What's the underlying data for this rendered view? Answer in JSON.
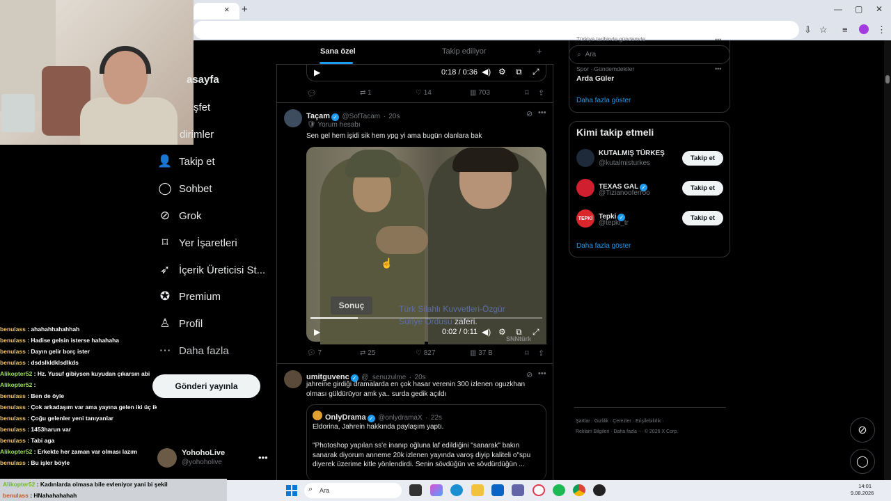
{
  "browser": {
    "new_tab": "+",
    "close_tab": "×",
    "win_min": "—",
    "win_max": "▢",
    "win_close": "✕"
  },
  "nav": {
    "home": "asayfa",
    "explore": "şfet",
    "notifications": "dirimler",
    "items": [
      {
        "label": "Takip et",
        "icon": "add-user-icon"
      },
      {
        "label": "Sohbet",
        "icon": "chat-icon"
      },
      {
        "label": "Grok",
        "icon": "grok-icon"
      },
      {
        "label": "Yer İşaretleri",
        "icon": "bookmark-icon"
      },
      {
        "label": "İçerik Üreticisi St...",
        "icon": "rocket-icon"
      },
      {
        "label": "Premium",
        "icon": "premium-icon"
      },
      {
        "label": "Profil",
        "icon": "profile-icon"
      },
      {
        "label": "Daha fazla",
        "icon": "more-icon"
      }
    ],
    "post_button": "Gönderi yayınla",
    "account_name": "YohohoLive",
    "account_handle": "@yohoholive",
    "account_more": "•••"
  },
  "chat": {
    "lines": [
      {
        "user": "benulass",
        "msg": ": ahahahhahahhah",
        "green": false
      },
      {
        "user": "benulass",
        "msg": ": Hadise gelsin isterse hahahaha",
        "green": false
      },
      {
        "user": "benulass",
        "msg": ": Dayın gelir borç ister",
        "green": false
      },
      {
        "user": "benulass",
        "msg": ": dsdslkldklsdlkds",
        "green": false
      },
      {
        "user": "Alikopter52",
        "msg": ": Hz. Yusuf gibiysen kuyudan çıkarsın abi",
        "green": true
      },
      {
        "user": "Alikopter52",
        "msg": ":",
        "green": true
      },
      {
        "user": "benulass",
        "msg": ": Ben de öyle",
        "green": false
      },
      {
        "user": "benulass",
        "msg": ": Çok arkadaşım var ama yayına gelen iki üç ikiş",
        "green": false
      },
      {
        "user": "benulass",
        "msg": ": Çoğu gelenler yeni tanıyanlar",
        "green": false
      },
      {
        "user": "benulass",
        "msg": ": 1453harun var",
        "green": false
      },
      {
        "user": "benulass",
        "msg": ": Tabi aga",
        "green": false
      },
      {
        "user": "Alikopter52",
        "msg": ": Erkekte her zaman var olması lazım",
        "green": true
      },
      {
        "user": "benulass",
        "msg": ": Bu işler böyle",
        "green": false
      }
    ],
    "bottom": [
      {
        "user": "Alikopter52",
        "msg": ": Kadınlarda olmasa bile evleniyor yani bi şekil"
      },
      {
        "user": "benulass",
        "msg": ": HNahahahahah"
      }
    ]
  },
  "timeline": {
    "tab_foryou": "Sana özel",
    "tab_following": "Takip ediliyor",
    "tab_plus": "+",
    "post1": {
      "time": "0:18 / 0:36",
      "replies": "",
      "reposts": "1",
      "likes": "14",
      "views": "703"
    },
    "post2": {
      "name": "Taçam",
      "handle": "@SofTacam",
      "time": "20s",
      "label": "Yorum hesabı",
      "text": "Sen  gel hem işidi sik hem ypg yi ama bugün olanlara bak",
      "video_badge": "Sonuç",
      "sub1": "Türk Silahlı Kuvvetleri-Özgür",
      "sub2_a": "Suriye Ordusu ",
      "sub2_b": "zaferi.",
      "watermark": "SNNtürk",
      "video_time": "0:02 / 0:11",
      "replies": "7",
      "reposts": "25",
      "likes": "827",
      "views": "37 B"
    },
    "post3": {
      "name": "umitguvenc",
      "handle": "@_senuzulme",
      "time": "20s",
      "text": "jahreine girdiği dramalarda en çok hasar verenin 300 izlenen oguzkhan olması güldürüyor amk ya.. surda gedik açıldı",
      "quote_name": "OnlyDrama",
      "quote_handle": "@onlydramaX",
      "quote_time": "22s",
      "quote_line1": "Eldorina, Jahrein hakkında paylaşım yaptı.",
      "quote_body": "\"Photoshop yapılan ss'e inanıp oğluna laf edildiğini \"sanarak\" bakın sanarak diyorum anneme 20k izlenen yayında varoş diyip kaliteli o\"spu diyerek üzerime kitle yönlendirdi. Senin sövdüğün ve sövdürdüğün ..."
    }
  },
  "right": {
    "search_placeholder": "Ara",
    "trend_header": "Türkiye tarihinde gündemde",
    "trend_cat": "Spor · Gündemdekiler",
    "trend_name": "Arda Güler",
    "show_more": "Daha fazla göster",
    "who_title": "Kimi takip etmeli",
    "who": [
      {
        "name": "KUTALMIŞ TÜRKEŞ",
        "handle": "@kutalmisturkes",
        "verified": false,
        "button": "Takip et"
      },
      {
        "name": "TEXAS GAL",
        "handle": "@Tizianooferroo",
        "verified": true,
        "button": "Takip et"
      },
      {
        "name": "Tepki",
        "handle": "@tepki_tr",
        "verified": true,
        "button": "Takip et"
      }
    ],
    "who_more": "Daha fazla göster",
    "footer1": "Şartlar  ·  Gizlilik  ·  Çerezler  ·  Erişilebilirlik  ·",
    "footer2": "Reklam Bilgileri  ·  Daha fazla ···  © 2026 X Corp."
  },
  "taskbar": {
    "search": "Ara",
    "time": "14:01",
    "date": "9.08.2026"
  },
  "colors": {
    "accent": "#1d9bf0",
    "bg": "#000000",
    "border": "#2f3336"
  }
}
